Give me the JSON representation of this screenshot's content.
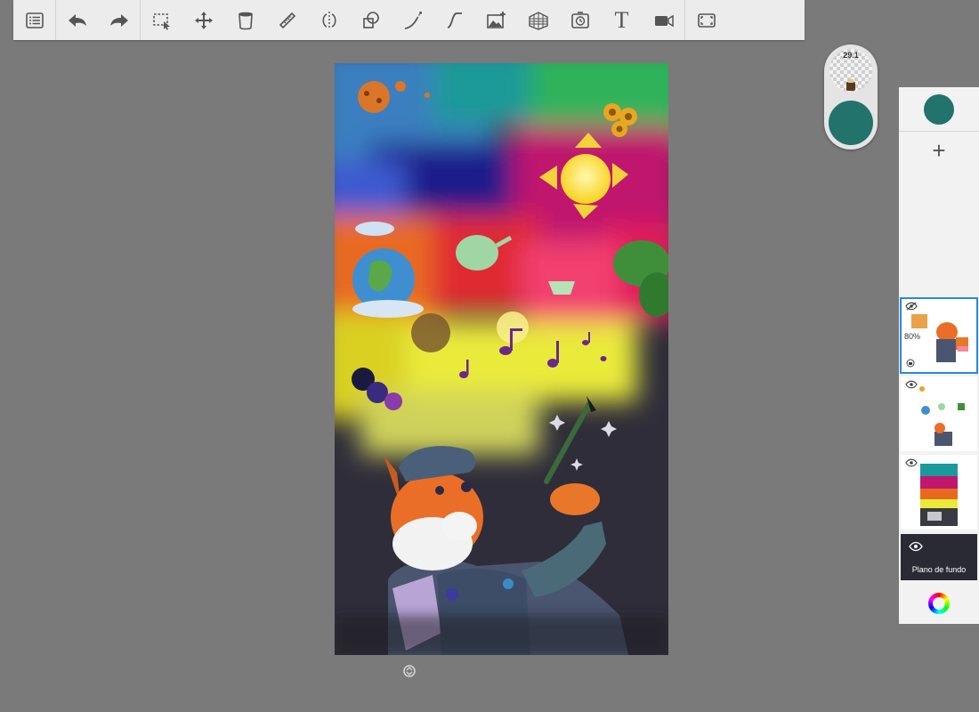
{
  "toolbar": {
    "tools": [
      {
        "name": "menu",
        "icon": "list-icon"
      },
      {
        "name": "undo",
        "icon": "undo-arrow-icon"
      },
      {
        "name": "redo",
        "icon": "redo-arrow-icon"
      },
      {
        "name": "selection",
        "icon": "selection-marquee-icon"
      },
      {
        "name": "transform",
        "icon": "move-arrows-icon"
      },
      {
        "name": "fill",
        "icon": "paint-bucket-icon"
      },
      {
        "name": "ruler",
        "icon": "ruler-icon"
      },
      {
        "name": "symmetry",
        "icon": "symmetry-icon"
      },
      {
        "name": "shapes",
        "icon": "shapes-icon"
      },
      {
        "name": "stroke",
        "icon": "stroke-curve-icon"
      },
      {
        "name": "curve",
        "icon": "curve-icon"
      },
      {
        "name": "import-image",
        "icon": "image-add-icon"
      },
      {
        "name": "perspective",
        "icon": "perspective-grid-icon"
      },
      {
        "name": "time-lapse",
        "icon": "time-lapse-icon"
      },
      {
        "name": "text",
        "icon": "text-icon",
        "label": "T"
      },
      {
        "name": "record",
        "icon": "video-record-icon"
      },
      {
        "name": "fullscreen",
        "icon": "fullscreen-icon"
      }
    ]
  },
  "brush": {
    "size": "29.1",
    "color": "#21736c"
  },
  "layers_panel": {
    "current_color": "#21736c",
    "add_label": "+",
    "layers": [
      {
        "visible": true,
        "selected": true,
        "opacity": "80%"
      },
      {
        "visible": true,
        "selected": false
      },
      {
        "visible": true,
        "selected": false
      }
    ],
    "background_label": "Plano de fundo"
  },
  "colors": {
    "toolbar_bg": "#ececec",
    "workspace_bg": "#7a7a7a",
    "selection_accent": "#2a88d8"
  }
}
